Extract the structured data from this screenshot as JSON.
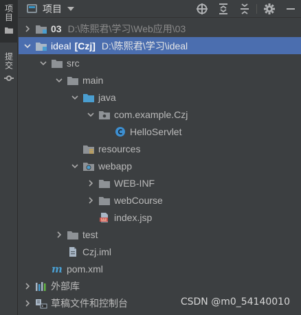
{
  "side_tabs": [
    {
      "label": "项目",
      "active": true
    },
    {
      "label": "提交",
      "active": false
    }
  ],
  "toolbar": {
    "title": "项目",
    "actions": [
      "locate-icon",
      "expand-all-icon",
      "collapse-all-icon",
      "settings-icon",
      "hide-icon"
    ]
  },
  "tree": {
    "n03": {
      "name": "03",
      "path": "D:\\陈熙君\\学习\\Web应用\\03"
    },
    "ideal": {
      "name": "ideal",
      "tag": "[Czj]",
      "path": "D:\\陈熙君\\学习\\ideal"
    },
    "src": "src",
    "main": "main",
    "java": "java",
    "pkg": "com.example.Czj",
    "servlet": "HelloServlet",
    "resources": "resources",
    "webapp": "webapp",
    "webinf": "WEB-INF",
    "webcourse": "webCourse",
    "indexjsp": "index.jsp",
    "test": "test",
    "czjiml": "Czj.iml",
    "pom": "pom.xml",
    "libs": "外部库",
    "scratches": "草稿文件和控制台"
  },
  "watermark": "CSDN @m0_54140010",
  "colors": {
    "background": "#3c3f41",
    "selection": "#4b6eaf",
    "folder": "#8e9296",
    "source_folder": "#4a9ed0",
    "class_icon": "#3d8fd1",
    "text": "#bbbbbb"
  }
}
